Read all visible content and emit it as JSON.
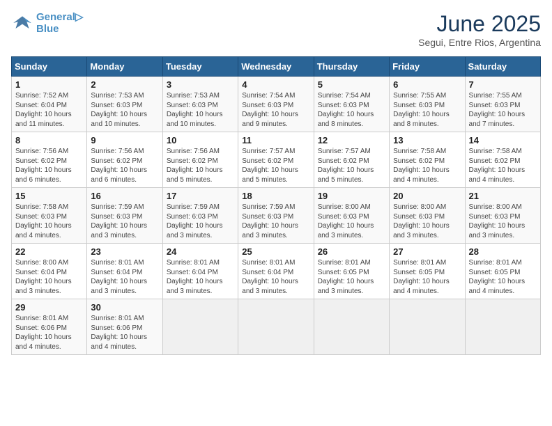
{
  "header": {
    "logo_line1": "General",
    "logo_line2": "Blue",
    "month": "June 2025",
    "location": "Segui, Entre Rios, Argentina"
  },
  "days_of_week": [
    "Sunday",
    "Monday",
    "Tuesday",
    "Wednesday",
    "Thursday",
    "Friday",
    "Saturday"
  ],
  "weeks": [
    [
      {
        "day": "1",
        "info": "Sunrise: 7:52 AM\nSunset: 6:04 PM\nDaylight: 10 hours\nand 11 minutes."
      },
      {
        "day": "2",
        "info": "Sunrise: 7:53 AM\nSunset: 6:03 PM\nDaylight: 10 hours\nand 10 minutes."
      },
      {
        "day": "3",
        "info": "Sunrise: 7:53 AM\nSunset: 6:03 PM\nDaylight: 10 hours\nand 10 minutes."
      },
      {
        "day": "4",
        "info": "Sunrise: 7:54 AM\nSunset: 6:03 PM\nDaylight: 10 hours\nand 9 minutes."
      },
      {
        "day": "5",
        "info": "Sunrise: 7:54 AM\nSunset: 6:03 PM\nDaylight: 10 hours\nand 8 minutes."
      },
      {
        "day": "6",
        "info": "Sunrise: 7:55 AM\nSunset: 6:03 PM\nDaylight: 10 hours\nand 8 minutes."
      },
      {
        "day": "7",
        "info": "Sunrise: 7:55 AM\nSunset: 6:03 PM\nDaylight: 10 hours\nand 7 minutes."
      }
    ],
    [
      {
        "day": "8",
        "info": "Sunrise: 7:56 AM\nSunset: 6:02 PM\nDaylight: 10 hours\nand 6 minutes."
      },
      {
        "day": "9",
        "info": "Sunrise: 7:56 AM\nSunset: 6:02 PM\nDaylight: 10 hours\nand 6 minutes."
      },
      {
        "day": "10",
        "info": "Sunrise: 7:56 AM\nSunset: 6:02 PM\nDaylight: 10 hours\nand 5 minutes."
      },
      {
        "day": "11",
        "info": "Sunrise: 7:57 AM\nSunset: 6:02 PM\nDaylight: 10 hours\nand 5 minutes."
      },
      {
        "day": "12",
        "info": "Sunrise: 7:57 AM\nSunset: 6:02 PM\nDaylight: 10 hours\nand 5 minutes."
      },
      {
        "day": "13",
        "info": "Sunrise: 7:58 AM\nSunset: 6:02 PM\nDaylight: 10 hours\nand 4 minutes."
      },
      {
        "day": "14",
        "info": "Sunrise: 7:58 AM\nSunset: 6:02 PM\nDaylight: 10 hours\nand 4 minutes."
      }
    ],
    [
      {
        "day": "15",
        "info": "Sunrise: 7:58 AM\nSunset: 6:03 PM\nDaylight: 10 hours\nand 4 minutes."
      },
      {
        "day": "16",
        "info": "Sunrise: 7:59 AM\nSunset: 6:03 PM\nDaylight: 10 hours\nand 3 minutes."
      },
      {
        "day": "17",
        "info": "Sunrise: 7:59 AM\nSunset: 6:03 PM\nDaylight: 10 hours\nand 3 minutes."
      },
      {
        "day": "18",
        "info": "Sunrise: 7:59 AM\nSunset: 6:03 PM\nDaylight: 10 hours\nand 3 minutes."
      },
      {
        "day": "19",
        "info": "Sunrise: 8:00 AM\nSunset: 6:03 PM\nDaylight: 10 hours\nand 3 minutes."
      },
      {
        "day": "20",
        "info": "Sunrise: 8:00 AM\nSunset: 6:03 PM\nDaylight: 10 hours\nand 3 minutes."
      },
      {
        "day": "21",
        "info": "Sunrise: 8:00 AM\nSunset: 6:03 PM\nDaylight: 10 hours\nand 3 minutes."
      }
    ],
    [
      {
        "day": "22",
        "info": "Sunrise: 8:00 AM\nSunset: 6:04 PM\nDaylight: 10 hours\nand 3 minutes."
      },
      {
        "day": "23",
        "info": "Sunrise: 8:01 AM\nSunset: 6:04 PM\nDaylight: 10 hours\nand 3 minutes."
      },
      {
        "day": "24",
        "info": "Sunrise: 8:01 AM\nSunset: 6:04 PM\nDaylight: 10 hours\nand 3 minutes."
      },
      {
        "day": "25",
        "info": "Sunrise: 8:01 AM\nSunset: 6:04 PM\nDaylight: 10 hours\nand 3 minutes."
      },
      {
        "day": "26",
        "info": "Sunrise: 8:01 AM\nSunset: 6:05 PM\nDaylight: 10 hours\nand 3 minutes."
      },
      {
        "day": "27",
        "info": "Sunrise: 8:01 AM\nSunset: 6:05 PM\nDaylight: 10 hours\nand 4 minutes."
      },
      {
        "day": "28",
        "info": "Sunrise: 8:01 AM\nSunset: 6:05 PM\nDaylight: 10 hours\nand 4 minutes."
      }
    ],
    [
      {
        "day": "29",
        "info": "Sunrise: 8:01 AM\nSunset: 6:06 PM\nDaylight: 10 hours\nand 4 minutes."
      },
      {
        "day": "30",
        "info": "Sunrise: 8:01 AM\nSunset: 6:06 PM\nDaylight: 10 hours\nand 4 minutes."
      },
      {
        "day": "",
        "info": ""
      },
      {
        "day": "",
        "info": ""
      },
      {
        "day": "",
        "info": ""
      },
      {
        "day": "",
        "info": ""
      },
      {
        "day": "",
        "info": ""
      }
    ]
  ]
}
